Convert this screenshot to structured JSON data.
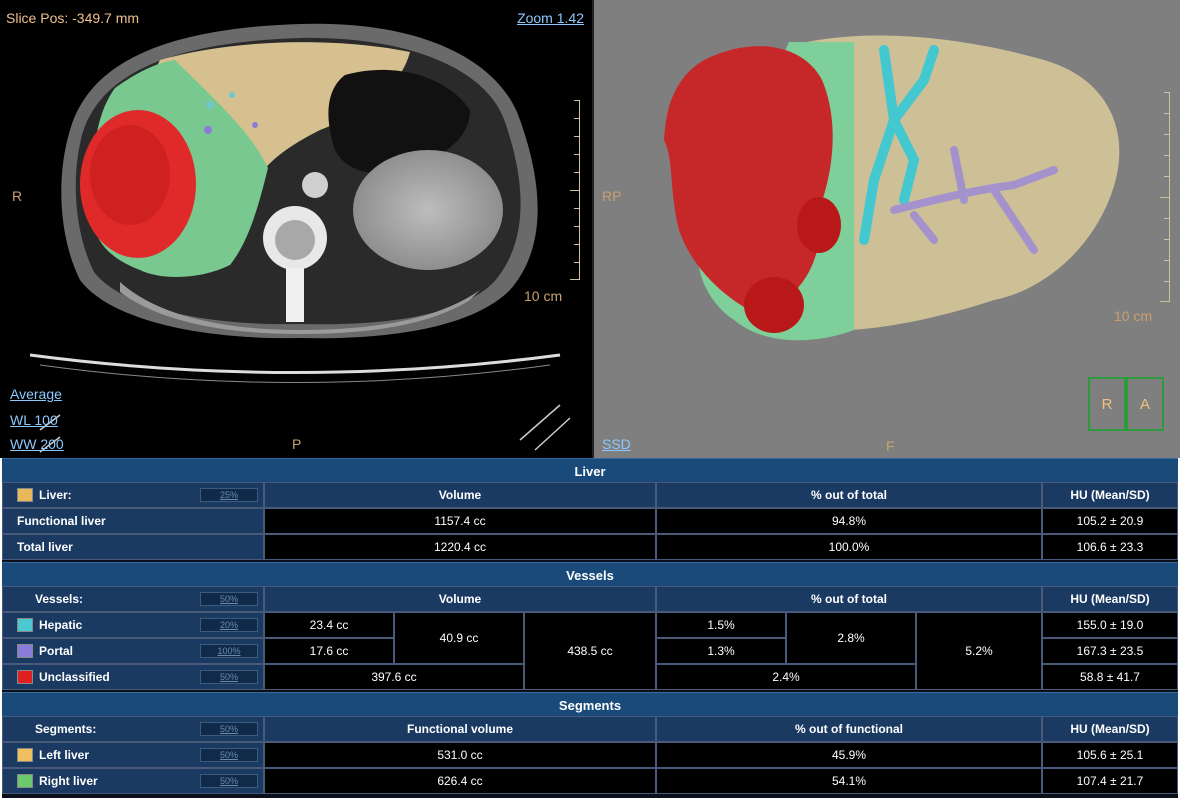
{
  "ct_view": {
    "slice_pos": "Slice Pos: -349.7 mm",
    "zoom": "Zoom 1.42",
    "left_orient": "R",
    "bottom_orient": "P",
    "scale_label": "10 cm",
    "render_mode": "Average",
    "wl": "WL 100",
    "ww": "WW 200"
  },
  "vr_view": {
    "left_orient": "RP",
    "bottom_orient": "F",
    "scale_label": "10 cm",
    "render_mode": "SSD",
    "orient_box": [
      "R",
      "A"
    ]
  },
  "colors": {
    "liver": "#e8b85a",
    "hepatic": "#4ec8d0",
    "portal": "#8a7cd8",
    "unclassified": "#e02020",
    "left_liver": "#f0c060",
    "right_liver": "#6cc86c"
  },
  "liver": {
    "title": "Liver",
    "label": "Liver:",
    "opacity": "25%",
    "headers": [
      "Volume",
      "% out of total",
      "HU (Mean/SD)"
    ],
    "rows": [
      {
        "name": "Functional liver",
        "volume": "1157.4 cc",
        "pct": "94.8%",
        "hu": "105.2 ± 20.9"
      },
      {
        "name": "Total liver",
        "volume": "1220.4 cc",
        "pct": "100.0%",
        "hu": "106.6 ± 23.3"
      }
    ]
  },
  "vessels": {
    "title": "Vessels",
    "label": "Vessels:",
    "opacity": "50%",
    "headers": [
      "Volume",
      "% out of total",
      "HU (Mean/SD)"
    ],
    "rows": [
      {
        "name": "Hepatic",
        "opacity": "20%",
        "volume": "23.4 cc",
        "pct": "1.5%",
        "hu": "155.0 ± 19.0"
      },
      {
        "name": "Portal",
        "opacity": "100%",
        "volume": "17.6 cc",
        "pct": "1.3%",
        "hu": "167.3 ± 23.5"
      },
      {
        "name": "Unclassified",
        "opacity": "50%",
        "volume": "397.6 cc",
        "pct": "2.4%",
        "hu": "58.8 ± 41.7"
      }
    ],
    "combined_volume": "40.9 cc",
    "combined_pct": "2.8%",
    "total_volume": "438.5 cc",
    "total_pct": "5.2%"
  },
  "segments": {
    "title": "Segments",
    "label": "Segments:",
    "opacity": "50%",
    "headers": [
      "Functional volume",
      "% out of functional",
      "HU (Mean/SD)"
    ],
    "rows": [
      {
        "name": "Left liver",
        "opacity": "50%",
        "volume": "531.0 cc",
        "pct": "45.9%",
        "hu": "105.6 ± 25.1"
      },
      {
        "name": "Right liver",
        "opacity": "50%",
        "volume": "626.4 cc",
        "pct": "54.1%",
        "hu": "107.4 ± 21.7"
      }
    ]
  }
}
